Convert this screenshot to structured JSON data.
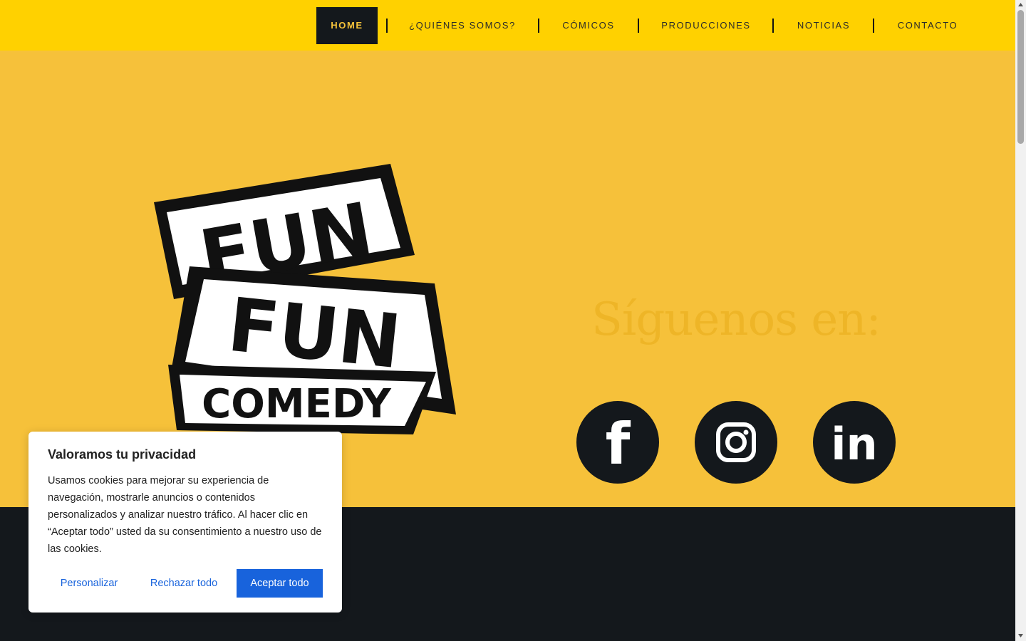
{
  "nav": {
    "items": [
      {
        "label": "HOME"
      },
      {
        "label": "¿QUIÉNES SOMOS?"
      },
      {
        "label": "CÓMICOS"
      },
      {
        "label": "PRODUCCIONES"
      },
      {
        "label": "NOTICIAS"
      },
      {
        "label": "CONTACTO"
      }
    ],
    "active": "HOME"
  },
  "hero": {
    "logo_text": [
      "FUN",
      "FUN",
      "COMEDY"
    ],
    "follow_title": "Síguenos en:",
    "social": [
      {
        "name": "facebook-icon",
        "glyph": "f"
      },
      {
        "name": "instagram-icon"
      },
      {
        "name": "linkedin-icon",
        "glyph": "in"
      }
    ]
  },
  "cookie_banner": {
    "title": "Valoramos tu privacidad",
    "text": "Usamos cookies para mejorar su experiencia de navegación, mostrarle anuncios o contenidos personalizados y analizar nuestro tráfico. Al hacer clic en “Aceptar todo” usted da su consentimiento a nuestro uso de las cookies.",
    "customize_label": "Personalizar",
    "reject_label": "Rechazar todo",
    "accept_label": "Aceptar todo"
  },
  "colors": {
    "nav_bg": "#ffd100",
    "hero_bg": "#f6c13a",
    "dark": "#14181c",
    "accent_blue": "#1863dc"
  }
}
